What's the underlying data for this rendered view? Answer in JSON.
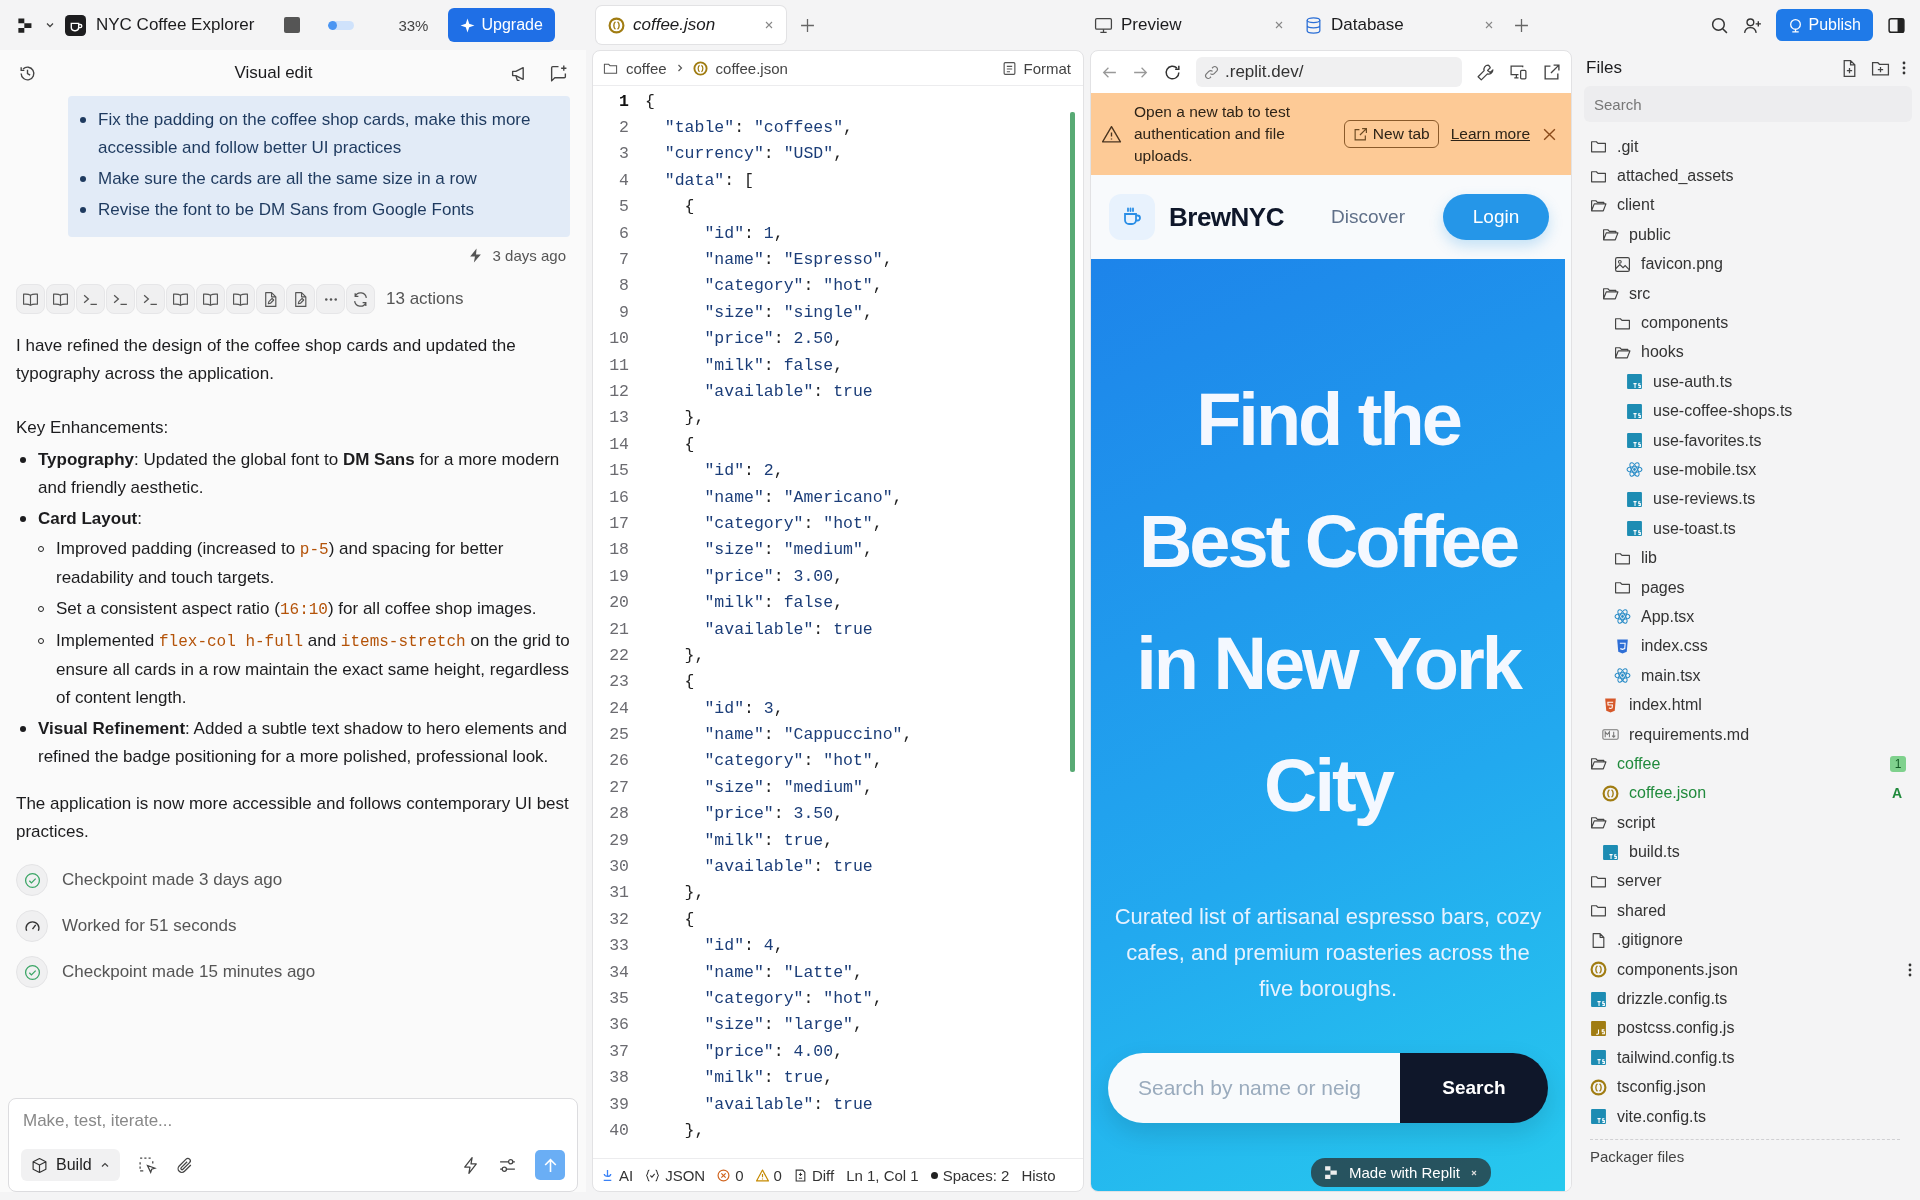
{
  "topbar": {
    "app_name": "NYC Coffee Explorer",
    "progress": {
      "level": 0.33,
      "reading": "33%"
    },
    "upgrade": "Upgrade",
    "editor_tabs": [
      {
        "label": "coffee.json",
        "selected": true
      }
    ],
    "preview_tabs": [
      {
        "label": "Preview",
        "kind": "preview"
      },
      {
        "label": "Database",
        "kind": "database"
      }
    ],
    "publish": "Publish"
  },
  "chat": {
    "title": "Visual edit",
    "request_items": [
      "Fix the padding on the coffee shop cards, make this more accessible and follow better UI practices",
      "Make sure the cards are all the same size in a row",
      "Revise the font to be DM Sans from Google Fonts"
    ],
    "request_time": "3 days ago",
    "actions": [
      {
        "kind": "book"
      },
      {
        "kind": "book"
      },
      {
        "kind": "terminal"
      },
      {
        "kind": "terminal"
      },
      {
        "kind": "terminal"
      },
      {
        "kind": "book"
      },
      {
        "kind": "book"
      },
      {
        "kind": "book"
      },
      {
        "kind": "file-edit"
      },
      {
        "kind": "file-edit"
      },
      {
        "kind": "more"
      },
      {
        "kind": "refresh"
      }
    ],
    "actions_label": "13 actions",
    "response": [
      {
        "kind": "paragraph",
        "segments": [
          {
            "kind": "text",
            "text": "I have refined the design of the coffee shop cards and updated the typography across the application."
          }
        ]
      },
      {
        "kind": "heading",
        "segments": [
          {
            "kind": "text",
            "text": "Key Enhancements:"
          }
        ]
      },
      {
        "kind": "list",
        "items": [
          {
            "segments": [
              {
                "kind": "bold",
                "text": "Typography"
              },
              {
                "kind": "text",
                "text": ": Updated the global font to "
              },
              {
                "kind": "bold",
                "text": "DM Sans"
              },
              {
                "kind": "text",
                "text": " for a more modern and friendly aesthetic."
              }
            ]
          },
          {
            "segments": [
              {
                "kind": "bold",
                "text": "Card Layout"
              },
              {
                "kind": "text",
                "text": ":"
              }
            ],
            "children": [
              {
                "segments": [
                  {
                    "kind": "text",
                    "text": "Improved padding (increased to "
                  },
                  {
                    "kind": "code",
                    "text": "p-5"
                  },
                  {
                    "kind": "text",
                    "text": ") and spacing for better readability and touch targets."
                  }
                ]
              },
              {
                "segments": [
                  {
                    "kind": "text",
                    "text": "Set a consistent aspect ratio ("
                  },
                  {
                    "kind": "code",
                    "text": "16:10"
                  },
                  {
                    "kind": "text",
                    "text": ") for all coffee shop images."
                  }
                ]
              },
              {
                "segments": [
                  {
                    "kind": "text",
                    "text": "Implemented "
                  },
                  {
                    "kind": "code",
                    "text": "flex-col h-full"
                  },
                  {
                    "kind": "text",
                    "text": " and "
                  },
                  {
                    "kind": "code",
                    "text": "items-stretch"
                  },
                  {
                    "kind": "text",
                    "text": " on the grid to ensure all cards in a row maintain the exact same height, regardless of content length."
                  }
                ]
              }
            ]
          },
          {
            "segments": [
              {
                "kind": "bold",
                "text": "Visual Refinement"
              },
              {
                "kind": "text",
                "text": ": Added a subtle text shadow to hero elements and refined the badge positioning for a more polished, professional look."
              }
            ]
          }
        ]
      },
      {
        "kind": "paragraph",
        "segments": [
          {
            "kind": "text",
            "text": "The application is now more accessible and follows contemporary UI best practices."
          }
        ]
      }
    ],
    "events": [
      {
        "kind": "checkpoint",
        "text": "Checkpoint made 3 days ago"
      },
      {
        "kind": "worked",
        "text": "Worked for 51 seconds"
      },
      {
        "kind": "checkpoint",
        "text": "Checkpoint made 15 minutes ago"
      }
    ],
    "composer": {
      "placeholder": "Make, test, iterate...",
      "mode": "Build"
    }
  },
  "editor": {
    "breadcrumb": [
      "coffee",
      "coffee.json"
    ],
    "format": "Format",
    "lines": [
      {
        "number": "1",
        "code": "{",
        "current": true
      },
      {
        "number": "2",
        "code": "  \"table\": \"coffees\",",
        "current": false
      },
      {
        "number": "3",
        "code": "  \"currency\": \"USD\",",
        "current": false
      },
      {
        "number": "4",
        "code": "  \"data\": [",
        "current": false
      },
      {
        "number": "5",
        "code": "    {",
        "current": false
      },
      {
        "number": "6",
        "code": "      \"id\": 1,",
        "current": false
      },
      {
        "number": "7",
        "code": "      \"name\": \"Espresso\",",
        "current": false
      },
      {
        "number": "8",
        "code": "      \"category\": \"hot\",",
        "current": false
      },
      {
        "number": "9",
        "code": "      \"size\": \"single\",",
        "current": false
      },
      {
        "number": "10",
        "code": "      \"price\": 2.50,",
        "current": false
      },
      {
        "number": "11",
        "code": "      \"milk\": false,",
        "current": false
      },
      {
        "number": "12",
        "code": "      \"available\": true",
        "current": false
      },
      {
        "number": "13",
        "code": "    },",
        "current": false
      },
      {
        "number": "14",
        "code": "    {",
        "current": false
      },
      {
        "number": "15",
        "code": "      \"id\": 2,",
        "current": false
      },
      {
        "number": "16",
        "code": "      \"name\": \"Americano\",",
        "current": false
      },
      {
        "number": "17",
        "code": "      \"category\": \"hot\",",
        "current": false
      },
      {
        "number": "18",
        "code": "      \"size\": \"medium\",",
        "current": false
      },
      {
        "number": "19",
        "code": "      \"price\": 3.00,",
        "current": false
      },
      {
        "number": "20",
        "code": "      \"milk\": false,",
        "current": false
      },
      {
        "number": "21",
        "code": "      \"available\": true",
        "current": false
      },
      {
        "number": "22",
        "code": "    },",
        "current": false
      },
      {
        "number": "23",
        "code": "    {",
        "current": false
      },
      {
        "number": "24",
        "code": "      \"id\": 3,",
        "current": false
      },
      {
        "number": "25",
        "code": "      \"name\": \"Cappuccino\",",
        "current": false
      },
      {
        "number": "26",
        "code": "      \"category\": \"hot\",",
        "current": false
      },
      {
        "number": "27",
        "code": "      \"size\": \"medium\",",
        "current": false
      },
      {
        "number": "28",
        "code": "      \"price\": 3.50,",
        "current": false
      },
      {
        "number": "29",
        "code": "      \"milk\": true,",
        "current": false
      },
      {
        "number": "30",
        "code": "      \"available\": true",
        "current": false
      },
      {
        "number": "31",
        "code": "    },",
        "current": false
      },
      {
        "number": "32",
        "code": "    {",
        "current": false
      },
      {
        "number": "33",
        "code": "      \"id\": 4,",
        "current": false
      },
      {
        "number": "34",
        "code": "      \"name\": \"Latte\",",
        "current": false
      },
      {
        "number": "35",
        "code": "      \"category\": \"hot\",",
        "current": false
      },
      {
        "number": "36",
        "code": "      \"size\": \"large\",",
        "current": false
      },
      {
        "number": "37",
        "code": "      \"price\": 4.00,",
        "current": false
      },
      {
        "number": "38",
        "code": "      \"milk\": true,",
        "current": false
      },
      {
        "number": "39",
        "code": "      \"available\": true",
        "current": false
      },
      {
        "number": "40",
        "code": "    },",
        "current": false
      }
    ],
    "status": [
      {
        "kind": "ai",
        "text": "AI"
      },
      {
        "kind": "json",
        "text": "JSON"
      },
      {
        "kind": "errors",
        "text": "0"
      },
      {
        "kind": "warnings",
        "text": "0"
      },
      {
        "kind": "diff",
        "text": "Diff"
      },
      {
        "kind": "plain",
        "text": "Ln 1, Col 1"
      },
      {
        "kind": "dot",
        "text": "Spaces: 2"
      },
      {
        "kind": "plain",
        "text": "Histo"
      }
    ]
  },
  "preview": {
    "url": ".replit.dev/",
    "banner": {
      "text": "Open a new tab to test authentication and file uploads.",
      "button": "New tab",
      "link": "Learn more"
    },
    "site": {
      "brand": "BrewNYC",
      "nav": "Discover",
      "login": "Login",
      "title": "Find the Best Coffee in New York City",
      "subtitle": "Curated list of artisanal espresso bars, cozy cafes, and premium roasteries across the five boroughs.",
      "search_placeholder": "Search by name or neig",
      "search_button": "Search"
    },
    "badge": "Made with Replit"
  },
  "files": {
    "title": "Files",
    "search_placeholder": "Search",
    "tree": [
      {
        "name": ".git",
        "kind": "folder",
        "expanded": false
      },
      {
        "name": "attached_assets",
        "kind": "folder",
        "expanded": false
      },
      {
        "name": "client",
        "kind": "folder",
        "expanded": true,
        "children": [
          {
            "name": "public",
            "kind": "folder",
            "expanded": true,
            "children": [
              {
                "name": "favicon.png",
                "kind": "image"
              }
            ]
          },
          {
            "name": "src",
            "kind": "folder",
            "expanded": true,
            "children": [
              {
                "name": "components",
                "kind": "folder",
                "expanded": false
              },
              {
                "name": "hooks",
                "kind": "folder",
                "expanded": true,
                "children": [
                  {
                    "name": "use-auth.ts",
                    "kind": "ts"
                  },
                  {
                    "name": "use-coffee-shops.ts",
                    "kind": "ts"
                  },
                  {
                    "name": "use-favorites.ts",
                    "kind": "ts"
                  },
                  {
                    "name": "use-mobile.tsx",
                    "kind": "tsx"
                  },
                  {
                    "name": "use-reviews.ts",
                    "kind": "ts"
                  },
                  {
                    "name": "use-toast.ts",
                    "kind": "ts"
                  }
                ]
              },
              {
                "name": "lib",
                "kind": "folder",
                "expanded": false
              },
              {
                "name": "pages",
                "kind": "folder",
                "expanded": false
              },
              {
                "name": "App.tsx",
                "kind": "tsx"
              },
              {
                "name": "index.css",
                "kind": "css"
              },
              {
                "name": "main.tsx",
                "kind": "tsx"
              }
            ]
          },
          {
            "name": "index.html",
            "kind": "html"
          },
          {
            "name": "requirements.md",
            "kind": "md"
          }
        ]
      },
      {
        "name": "coffee",
        "kind": "folder",
        "expanded": true,
        "badge": "1",
        "children": [
          {
            "name": "coffee.json",
            "kind": "json",
            "git": "A"
          }
        ]
      },
      {
        "name": "script",
        "kind": "folder",
        "expanded": true,
        "children": [
          {
            "name": "build.ts",
            "kind": "ts"
          }
        ]
      },
      {
        "name": "server",
        "kind": "folder",
        "expanded": false
      },
      {
        "name": "shared",
        "kind": "folder",
        "expanded": false
      },
      {
        "name": ".gitignore",
        "kind": "file"
      },
      {
        "name": "components.json",
        "kind": "json",
        "menu": true
      },
      {
        "name": "drizzle.config.ts",
        "kind": "ts"
      },
      {
        "name": "postcss.config.js",
        "kind": "js"
      },
      {
        "name": "tailwind.config.ts",
        "kind": "ts"
      },
      {
        "name": "tsconfig.json",
        "kind": "json"
      },
      {
        "name": "vite.config.ts",
        "kind": "ts"
      }
    ],
    "footer": "Packager files"
  }
}
